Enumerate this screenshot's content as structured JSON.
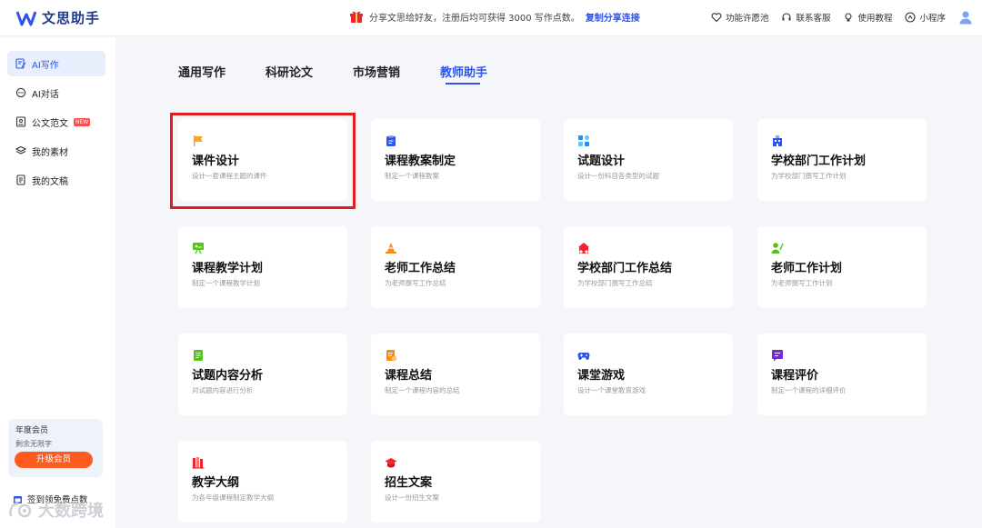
{
  "app": {
    "logo_text": "文思助手"
  },
  "promo": {
    "text": "分享文思给好友，注册后均可获得 3000 写作点数。",
    "link": "复制分享连接"
  },
  "top_actions": [
    {
      "label": "功能许愿池",
      "icon": "heart-icon"
    },
    {
      "label": "联系客服",
      "icon": "headset-icon"
    },
    {
      "label": "使用教程",
      "icon": "lightbulb-icon"
    },
    {
      "label": "小程序",
      "icon": "miniprogram-icon"
    }
  ],
  "sidebar": {
    "items": [
      {
        "label": "AI写作",
        "icon": "write-icon",
        "active": true
      },
      {
        "label": "AI对话",
        "icon": "chat-icon"
      },
      {
        "label": "公文范文",
        "icon": "document-icon",
        "badge": "NEW"
      },
      {
        "label": "我的素材",
        "icon": "layers-icon"
      },
      {
        "label": "我的文稿",
        "icon": "file-icon"
      }
    ],
    "vip": {
      "title": "年度会员",
      "subtitle": "剩余无限字",
      "button": "升级会员"
    },
    "signin": "签到领免费点数"
  },
  "tabs": [
    {
      "label": "通用写作"
    },
    {
      "label": "科研论文"
    },
    {
      "label": "市场营销"
    },
    {
      "label": "教师助手",
      "active": true
    }
  ],
  "cards": [
    {
      "title": "课件设计",
      "desc": "设计一套课程主题的课件",
      "icon": "flag-icon",
      "color": "#f5a623"
    },
    {
      "title": "课程教案制定",
      "desc": "制定一个课程教案",
      "icon": "clipboard-icon",
      "color": "#2f54eb"
    },
    {
      "title": "试题设计",
      "desc": "设计一份科目各类型的试题",
      "icon": "grid-icon",
      "color": "#1890ff"
    },
    {
      "title": "学校部门工作计划",
      "desc": "为学校部门撰写工作计划",
      "icon": "building-icon",
      "color": "#2f54eb"
    },
    {
      "title": "课程教学计划",
      "desc": "制定一个课程教学计划",
      "icon": "easel-icon",
      "color": "#52c41a"
    },
    {
      "title": "老师工作总结",
      "desc": "为老师撰写工作总结",
      "icon": "cone-icon",
      "color": "#fa8c16"
    },
    {
      "title": "学校部门工作总结",
      "desc": "为学校部门撰写工作总结",
      "icon": "school-icon",
      "color": "#f5222d"
    },
    {
      "title": "老师工作计划",
      "desc": "为老师撰写工作计划",
      "icon": "teacher-icon",
      "color": "#52c41a"
    },
    {
      "title": "试题内容分析",
      "desc": "对试题内容进行分析",
      "icon": "book-icon",
      "color": "#52c41a"
    },
    {
      "title": "课程总结",
      "desc": "制定一个课程内容的总结",
      "icon": "notes-icon",
      "color": "#fa8c16"
    },
    {
      "title": "课堂游戏",
      "desc": "设计一个课堂教育游戏",
      "icon": "gamepad-icon",
      "color": "#2f54eb"
    },
    {
      "title": "课程评价",
      "desc": "制定一个课程的详细评价",
      "icon": "comment-icon",
      "color": "#722ed1"
    },
    {
      "title": "教学大纲",
      "desc": "为各年级课程制定教学大纲",
      "icon": "books-icon",
      "color": "#f5222d"
    },
    {
      "title": "招生文案",
      "desc": "设计一份招生文案",
      "icon": "graduation-cap-icon",
      "color": "#f5222d"
    }
  ],
  "watermark": "大数跨境"
}
